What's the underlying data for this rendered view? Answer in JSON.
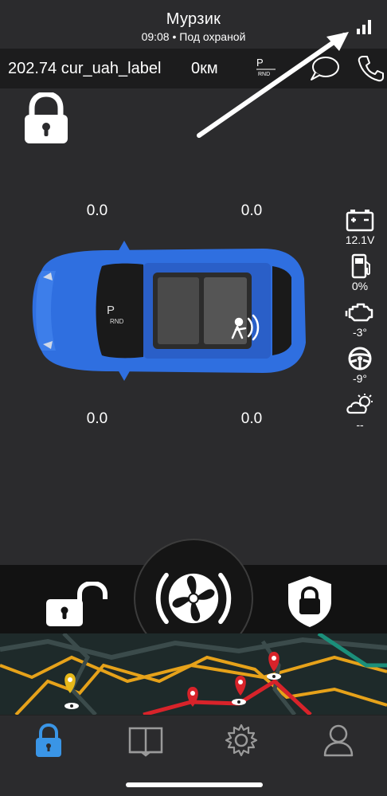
{
  "header": {
    "title": "Мурзик",
    "subtitle": "09:08 • Под охраной"
  },
  "infobar": {
    "balance": "202.74 cur_uah_label",
    "mileage": "0км",
    "gear_label": "P RND"
  },
  "tires": {
    "front_left": "0.0",
    "front_right": "0.0",
    "rear_left": "0.0",
    "rear_right": "0.0"
  },
  "car": {
    "color": "#2f6fe0",
    "gear_label": "P RND"
  },
  "sensors": [
    {
      "icon": "battery-icon",
      "value": "12.1V"
    },
    {
      "icon": "fuel-icon",
      "value": "0%"
    },
    {
      "icon": "engine-icon",
      "value": "-3°"
    },
    {
      "icon": "steering-wheel-icon",
      "value": "-9°"
    },
    {
      "icon": "weather-icon",
      "value": "--"
    }
  ],
  "controls": {
    "unlock": "unlock-icon",
    "engine": "fan-icon",
    "lock": "shield-lock-icon"
  },
  "tabs": [
    {
      "icon": "lock-icon",
      "active": true
    },
    {
      "icon": "book-icon",
      "active": false
    },
    {
      "icon": "gear-icon",
      "active": false
    },
    {
      "icon": "user-icon",
      "active": false
    }
  ],
  "colors": {
    "background": "#2b2b2d",
    "bar": "#1c1c1d",
    "accent": "#3a95e6",
    "car": "#2f6fe0"
  }
}
